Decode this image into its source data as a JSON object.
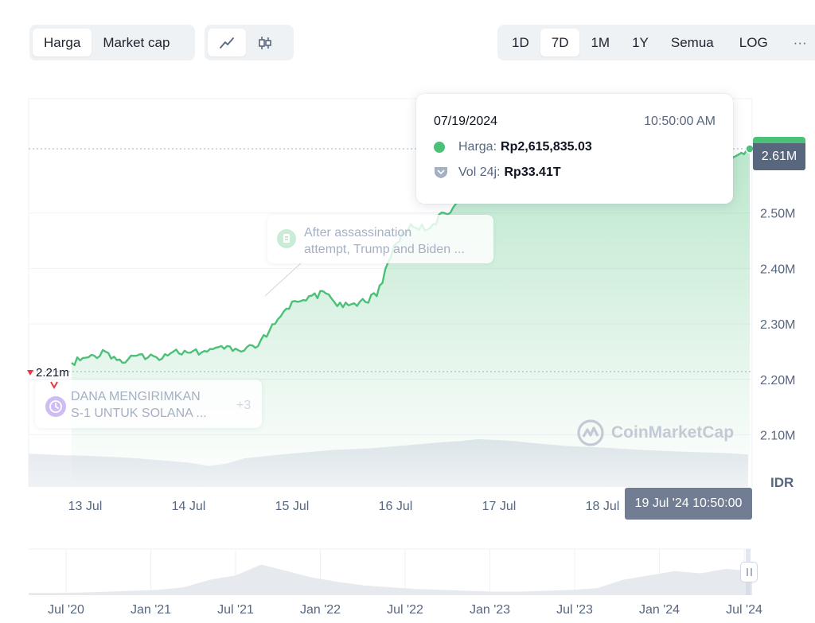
{
  "toolbar": {
    "metric_tabs": [
      "Harga",
      "Market cap"
    ],
    "active_metric": "Harga",
    "chart_kind_icons": [
      "line-chart-icon",
      "candlestick-icon"
    ],
    "ranges": [
      "1D",
      "7D",
      "1M",
      "1Y",
      "Semua"
    ],
    "active_range": "7D",
    "log_label": "LOG",
    "more_label": "···"
  },
  "tooltip": {
    "date": "07/19/2024",
    "time": "10:50:00 AM",
    "price_label": "Harga:",
    "price_value": "Rp2,615,835.03",
    "vol_label": "Vol 24j:",
    "vol_value": "Rp33.41T"
  },
  "news": [
    {
      "line1": "After assassination",
      "line2": "attempt, Trump and Biden ...",
      "icon": "document-icon"
    },
    {
      "line1": "DANA MENGIRIMKAN",
      "line2": "S-1 UNTUK SOLANA ...",
      "icon": "clock-icon",
      "more": "+3"
    }
  ],
  "markers": {
    "current_price": "2.61M",
    "low_price": "2.21m",
    "hover_time": "19 Jul '24 10:50:00",
    "currency": "IDR"
  },
  "watermark": "CoinMarketCap",
  "colors": {
    "up": "#4cc079",
    "down": "#ea3943",
    "tag": "#58667e"
  },
  "chart_data": {
    "type": "area",
    "y_unit": "IDR",
    "ylim": [
      2050000,
      2650000
    ],
    "y_ticks": [
      "2.10M",
      "2.20M",
      "2.30M",
      "2.40M",
      "2.50M"
    ],
    "x_ticks": [
      "13 Jul",
      "14 Jul",
      "15 Jul",
      "16 Jul",
      "17 Jul",
      "18 Jul"
    ],
    "price": [
      [
        "12 Jul 20:00",
        2230000
      ],
      [
        "13 Jul 00:00",
        2240000
      ],
      [
        "13 Jul 04:00",
        2250000
      ],
      [
        "13 Jul 08:00",
        2230000
      ],
      [
        "13 Jul 12:00",
        2245000
      ],
      [
        "13 Jul 16:00",
        2240000
      ],
      [
        "13 Jul 20:00",
        2250000
      ],
      [
        "14 Jul 00:00",
        2248000
      ],
      [
        "14 Jul 04:00",
        2250000
      ],
      [
        "14 Jul 08:00",
        2255000
      ],
      [
        "14 Jul 12:00",
        2250000
      ],
      [
        "14 Jul 16:00",
        2260000
      ],
      [
        "14 Jul 20:00",
        2300000
      ],
      [
        "15 Jul 00:00",
        2340000
      ],
      [
        "15 Jul 04:00",
        2350000
      ],
      [
        "15 Jul 08:00",
        2355000
      ],
      [
        "15 Jul 12:00",
        2330000
      ],
      [
        "15 Jul 16:00",
        2340000
      ],
      [
        "15 Jul 20:00",
        2350000
      ],
      [
        "16 Jul 00:00",
        2440000
      ],
      [
        "16 Jul 04:00",
        2480000
      ],
      [
        "16 Jul 08:00",
        2470000
      ],
      [
        "16 Jul 12:00",
        2500000
      ],
      [
        "16 Jul 16:00",
        2520000
      ],
      [
        "16 Jul 20:00",
        2545000
      ],
      [
        "17 Jul 00:00",
        2565000
      ],
      [
        "17 Jul 04:00",
        2540000
      ],
      [
        "17 Jul 08:00",
        2525000
      ],
      [
        "17 Jul 12:00",
        2540000
      ],
      [
        "17 Jul 16:00",
        2550000
      ],
      [
        "17 Jul 20:00",
        2545000
      ],
      [
        "18 Jul 00:00",
        2550000
      ],
      [
        "18 Jul 04:00",
        2540000
      ],
      [
        "18 Jul 08:00",
        2548000
      ],
      [
        "18 Jul 12:00",
        2545000
      ],
      [
        "18 Jul 16:00",
        2550000
      ],
      [
        "18 Jul 20:00",
        2570000
      ],
      [
        "19 Jul 00:00",
        2580000
      ],
      [
        "19 Jul 04:00",
        2560000
      ],
      [
        "19 Jul 08:00",
        2600000
      ],
      [
        "19 Jul 10:50",
        2615835
      ]
    ],
    "volume_relative": [
      0.62,
      0.6,
      0.58,
      0.57,
      0.55,
      0.53,
      0.5,
      0.46,
      0.42,
      0.38,
      0.3,
      0.36,
      0.5,
      0.55,
      0.6,
      0.64,
      0.68,
      0.72,
      0.74,
      0.76,
      0.8,
      0.84,
      0.88,
      0.92,
      0.95,
      1.0,
      0.98,
      0.95,
      0.9,
      0.86,
      0.82,
      0.8,
      0.78,
      0.75,
      0.72,
      0.7,
      0.68,
      0.66,
      0.65,
      0.63,
      0.6
    ],
    "navigator": {
      "x_ticks": [
        "Jul '20",
        "Jan '21",
        "Jul '21",
        "Jan '22",
        "Jul '22",
        "Jan '23",
        "Jul '23",
        "Jan '24",
        "Jul '24"
      ],
      "series_relative": [
        0.05,
        0.05,
        0.06,
        0.08,
        0.1,
        0.12,
        0.18,
        0.35,
        0.45,
        0.7,
        0.55,
        0.4,
        0.3,
        0.22,
        0.18,
        0.14,
        0.12,
        0.1,
        0.08,
        0.08,
        0.1,
        0.12,
        0.16,
        0.35,
        0.45,
        0.55,
        0.5,
        0.6,
        0.55
      ]
    }
  }
}
